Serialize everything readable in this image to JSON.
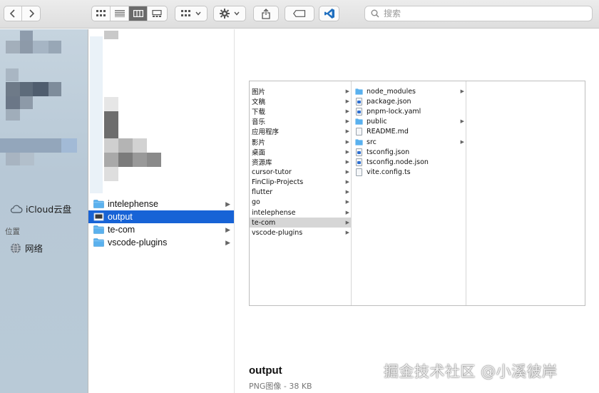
{
  "toolbar": {
    "search_placeholder": "搜索",
    "view_modes": [
      "icon-view",
      "list-view",
      "column-view",
      "gallery-view"
    ],
    "active_view": "column-view"
  },
  "colors": {
    "accent": "#1763d6",
    "sidebar": "#bccbd8",
    "selection_gray": "#d6d6d6",
    "folder": "#5ab1ee"
  },
  "sidebar": {
    "icloud_label": "iCloud云盘",
    "locations_header": "位置",
    "network_label": "网络"
  },
  "column1": {
    "items": [
      {
        "label": "intelephense",
        "type": "folder",
        "has_children": true,
        "selected": false
      },
      {
        "label": "output",
        "type": "image",
        "has_children": false,
        "selected": true
      },
      {
        "label": "te-com",
        "type": "folder",
        "has_children": true,
        "selected": false
      },
      {
        "label": "vscode-plugins",
        "type": "folder",
        "has_children": true,
        "selected": false
      }
    ]
  },
  "preview": {
    "thumbnail": {
      "col1": [
        "图片",
        "文稿",
        "下载",
        "音乐",
        "应用程序",
        "影片",
        "桌面",
        "资源库",
        "cursor-tutor",
        "FinClip-Projects",
        "flutter",
        "go",
        "intelephense",
        "te-com",
        "vscode-plugins"
      ],
      "col1_selected": "te-com",
      "col2": [
        {
          "label": "node_modules",
          "type": "folder",
          "has_children": true
        },
        {
          "label": "package.json",
          "type": "json"
        },
        {
          "label": "pnpm-lock.yaml",
          "type": "file"
        },
        {
          "label": "public",
          "type": "folder",
          "has_children": true
        },
        {
          "label": "README.md",
          "type": "doc"
        },
        {
          "label": "src",
          "type": "folder",
          "has_children": true
        },
        {
          "label": "tsconfig.json",
          "type": "json"
        },
        {
          "label": "tsconfig.node.json",
          "type": "json"
        },
        {
          "label": "vite.config.ts",
          "type": "ts"
        }
      ]
    },
    "file_name": "output",
    "file_info": "PNG图像 - 38 KB"
  },
  "watermark": "掘金技术社区 @小溪彼岸"
}
